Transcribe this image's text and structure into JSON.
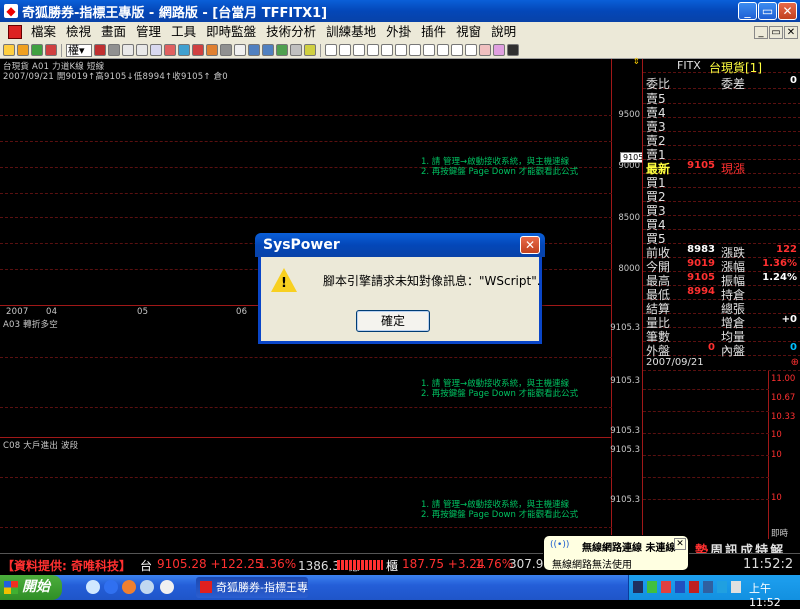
{
  "window": {
    "title": "奇狐勝券-指標王專版 - 網路版 - [台當月 TFFITX1]",
    "min_label": "_",
    "max_label": "▭",
    "close_label": "✕"
  },
  "menu": [
    "檔案",
    "檢視",
    "畫面",
    "管理",
    "工具",
    "即時監盤",
    "技術分析",
    "訓練基地",
    "外掛",
    "插件",
    "視窗",
    "說明"
  ],
  "mdi": {
    "min": "_",
    "restore": "▭",
    "close": "✕"
  },
  "toolbar": {
    "combo": "權▾"
  },
  "chart": {
    "pane1": {
      "header": "台現貨 A01 力道K線 短線",
      "info": "2007/09/21 開9019↑高9105↓低8994↑收9105↑ 倉0",
      "notice1": "1. 請 管理→啟動接收系統，與主機連線",
      "notice2": "2. 再按鍵盤 Page Down 才能觀看此公式",
      "yticks": [
        "9500",
        "9000",
        "8500",
        "8000"
      ],
      "cursor_value": "9105"
    },
    "date_axis": [
      "2007",
      "04",
      "05",
      "06"
    ],
    "pane2": {
      "header": "A03 轉折多空",
      "notice1": "1. 請 管理→啟動接收系統，與主機連線",
      "notice2": "2. 再按鍵盤 Page Down 才能觀看此公式",
      "ytick_top": "9105.3",
      "ytick_mid": "9105.3",
      "ytick_bot": "9105.3"
    },
    "pane3": {
      "header": "C08 大戶進出 波段",
      "notice1": "1. 請 管理→啟動接收系統，與主機連線",
      "notice2": "2. 再按鍵盤 Page Down 才能觀看此公式",
      "ytick_top": "9105.3",
      "ytick_mid": "9105.3"
    }
  },
  "panel": {
    "code": "FITX",
    "name": "台現貨[1]",
    "weibi": "委比",
    "weicha": "委差",
    "weicha_val": "0",
    "asks": [
      "賣5",
      "賣4",
      "賣3",
      "賣2",
      "賣1"
    ],
    "last_label": "最新",
    "last_value": "9105",
    "last_type": "現漲",
    "bids": [
      "買1",
      "買2",
      "買3",
      "買4",
      "買5"
    ],
    "stats": [
      {
        "l1": "前收",
        "v1": "8983",
        "l2": "漲跌",
        "v2": "122",
        "c1": "#ffffff",
        "c2": "#ff3030"
      },
      {
        "l1": "今開",
        "v1": "9019",
        "l2": "漲幅",
        "v2": "1.36%",
        "c1": "#ff3030",
        "c2": "#ff3030"
      },
      {
        "l1": "最高",
        "v1": "9105",
        "l2": "振幅",
        "v2": "1.24%",
        "c1": "#ff3030",
        "c2": "#ffffff"
      },
      {
        "l1": "最低",
        "v1": "8994",
        "l2": "持倉",
        "v2": "",
        "c1": "#ff3030",
        "c2": "#ffffff"
      },
      {
        "l1": "結算",
        "v1": "",
        "l2": "總張",
        "v2": "",
        "c1": "#ffffff",
        "c2": "#ffffff"
      },
      {
        "l1": "量比",
        "v1": "",
        "l2": "增倉",
        "v2": "+0",
        "c1": "#ffffff",
        "c2": "#ffffff"
      },
      {
        "l1": "筆數",
        "v1": "",
        "l2": "均量",
        "v2": "",
        "c1": "#ffffff",
        "c2": "#ffffff"
      },
      {
        "l1": "外盤",
        "v1": "0",
        "l2": "內盤",
        "v2": "0",
        "c1": "#ff3030",
        "c2": "#00c0ff"
      }
    ],
    "date": "2007/09/21",
    "mini_ticks": [
      "11.00",
      "10.67",
      "10.33",
      "10",
      "10",
      "10"
    ],
    "mini_footer": "即時",
    "tabs": [
      "勢",
      "周",
      "訊",
      "成",
      "特",
      "解"
    ]
  },
  "ticker": {
    "provider": "【資料提供: 奇唯科技】",
    "tw_label": "台",
    "tw_value": "9105.28 +122.25",
    "tw_pct": "1.36%",
    "tw_vol": "1386.32億",
    "ot_label": "櫃",
    "ot_value": "187.75 +3.24",
    "ot_pct": "1.76%",
    "ot_vol": "307.92",
    "clock": "11:52:2"
  },
  "dialog": {
    "title": "SysPower",
    "message": "腳本引擎請求未知對像訊息：\"WScript\".",
    "ok": "確定",
    "close": "✕"
  },
  "balloon": {
    "title": "無線網路連線 未連線",
    "body": "無線網路無法使用",
    "close": "✕"
  },
  "taskbar": {
    "start": "開始",
    "task": "奇狐勝券-指標王專...",
    "time": "上午 11:52"
  },
  "colors": {
    "grid": "#a01818",
    "notice": "#00c060",
    "up": "#ff3030",
    "down": "#00c0ff"
  }
}
